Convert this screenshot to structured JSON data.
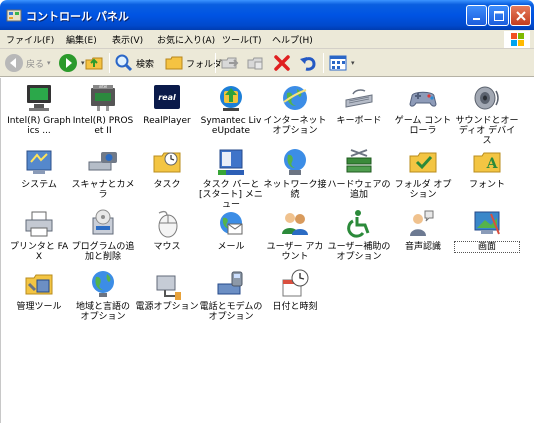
{
  "window": {
    "title": "コントロール パネル"
  },
  "menu": [
    "ファイル(F)",
    "編集(E)",
    "表示(V)",
    "お気に入り(A)",
    "ツール(T)",
    "ヘルプ(H)"
  ],
  "toolbar": {
    "back": "戻る",
    "search": "検索",
    "folders": "フォルダ"
  },
  "items": [
    {
      "label": "Intel(R) Graphics ..."
    },
    {
      "label": "Intel(R) PROSet II"
    },
    {
      "label": "RealPlayer"
    },
    {
      "label": "Symantec LiveUpdate"
    },
    {
      "label": "インターネット オプション"
    },
    {
      "label": "キーボード"
    },
    {
      "label": "ゲーム コントローラ"
    },
    {
      "label": "サウンドとオーディオ デバイス"
    },
    {
      "label": "システム"
    },
    {
      "label": "スキャナとカメラ"
    },
    {
      "label": "タスク"
    },
    {
      "label": "タスク バーと [スタート] メニュー"
    },
    {
      "label": "ネットワーク接続"
    },
    {
      "label": "ハードウェアの追加"
    },
    {
      "label": "フォルダ オプション"
    },
    {
      "label": "フォント"
    },
    {
      "label": "プリンタと FAX"
    },
    {
      "label": "プログラムの追加と削除"
    },
    {
      "label": "マウス"
    },
    {
      "label": "メール"
    },
    {
      "label": "ユーザー アカウント"
    },
    {
      "label": "ユーザー補助のオプション"
    },
    {
      "label": "音声認識"
    },
    {
      "label": "画面"
    },
    {
      "label": "管理ツール"
    },
    {
      "label": "地域と言語の オプション"
    },
    {
      "label": "電源オプション"
    },
    {
      "label": "電話とモデムの オプション"
    },
    {
      "label": "日付と時刻"
    }
  ]
}
